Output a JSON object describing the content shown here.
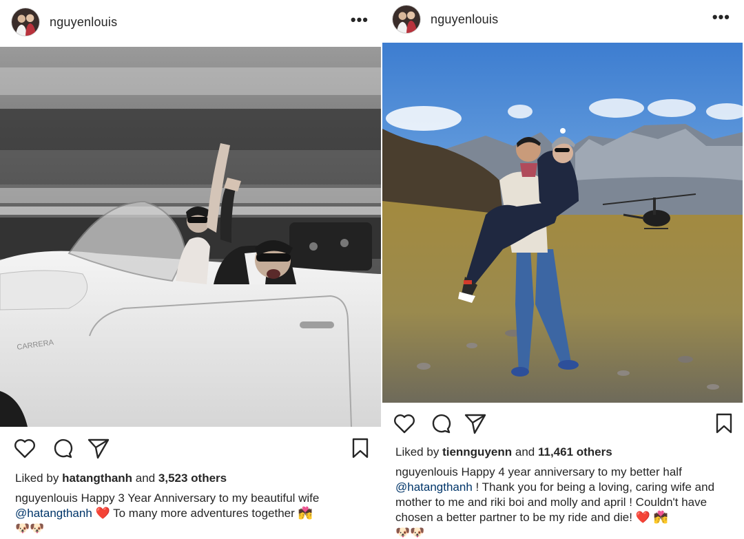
{
  "posts": [
    {
      "username": "nguyenlouis",
      "more_label": "•••",
      "photo_subject": "black-and-white photo of a couple waving from a convertible car",
      "likes_prefix": "Liked by",
      "liked_by": "hatangthanh",
      "likes_and": "and",
      "likes_count": "3,523 others",
      "caption_user": "nguyenlouis",
      "caption_text_1": "Happy 3 Year Anniversary to my beautiful wife",
      "caption_mention": "@hatangthanh",
      "caption_heart": "❤️",
      "caption_text_2": "To many more adventures together",
      "caption_couple_emoji": "💏",
      "caption_dogs": "🐶🐶"
    },
    {
      "username": "nguyenlouis",
      "more_label": "•••",
      "photo_subject": "man carrying woman on a mountain with a helicopter in the background",
      "likes_prefix": "Liked by",
      "liked_by": "tiennguyenn",
      "likes_and": "and",
      "likes_count": "11,461 others",
      "caption_user": "nguyenlouis",
      "caption_text_1": "Happy 4 year anniversary to my better half",
      "caption_mention": "@hatangthanh",
      "caption_text_2": "! Thank you for being a loving, caring wife and mother to me and riki boi and molly and april ! Couldn't have chosen a better partner to be my ride and die!",
      "caption_heart": "❤️",
      "caption_couple_emoji": "💏",
      "caption_dogs": "🐶🐶"
    }
  ],
  "icons": {
    "like": "heart-icon",
    "comment": "comment-icon",
    "share": "paper-plane-icon",
    "save": "bookmark-icon"
  },
  "colors": {
    "text": "#262626",
    "mention": "#003569",
    "heart": "#e0222e"
  }
}
